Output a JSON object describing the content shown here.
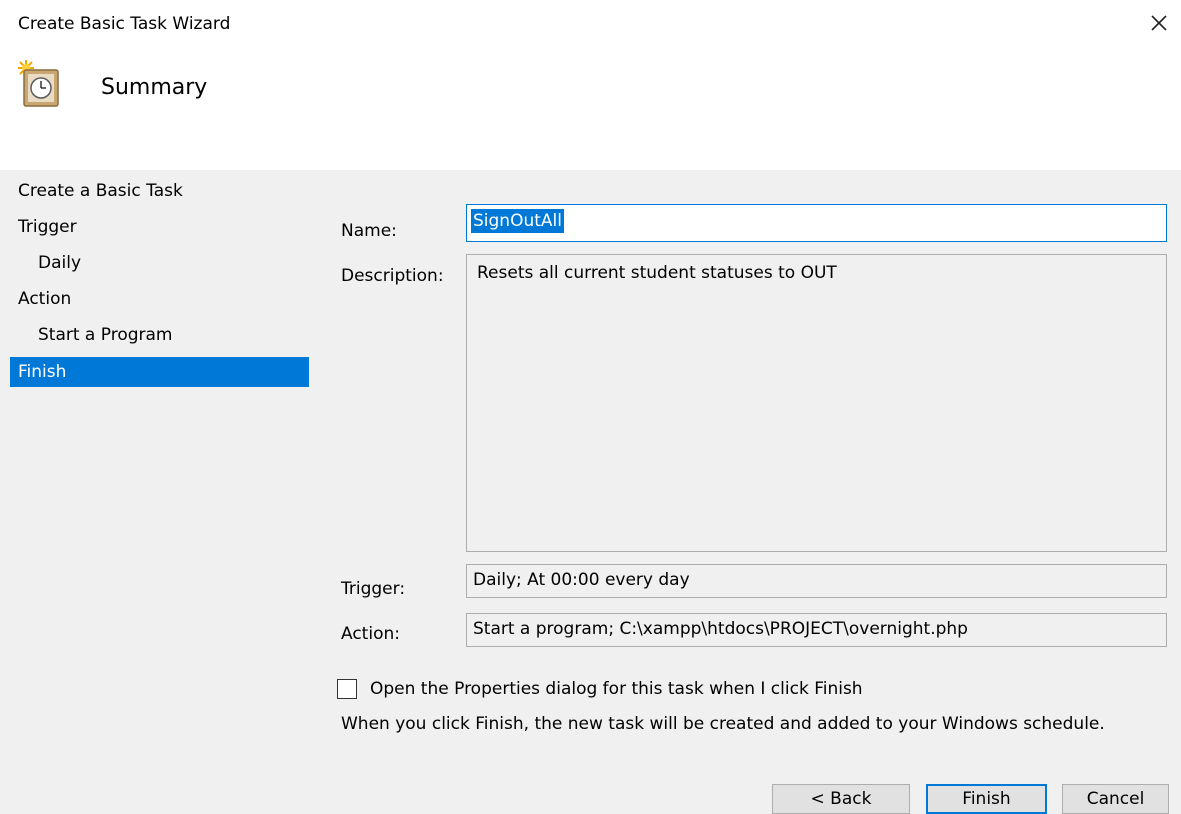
{
  "window": {
    "title": "Create Basic Task Wizard",
    "close_icon": "close-icon"
  },
  "header": {
    "icon": "task-clock-icon",
    "title": "Summary"
  },
  "nav": {
    "items": [
      {
        "label": "Create a Basic Task",
        "indent": false,
        "active": false
      },
      {
        "label": "Trigger",
        "indent": false,
        "active": false
      },
      {
        "label": "Daily",
        "indent": true,
        "active": false
      },
      {
        "label": "Action",
        "indent": false,
        "active": false
      },
      {
        "label": "Start a Program",
        "indent": true,
        "active": false
      },
      {
        "label": "Finish",
        "indent": false,
        "active": true
      }
    ]
  },
  "form": {
    "name_label": "Name:",
    "name_value": "SignOutAll",
    "description_label": "Description:",
    "description_value": "Resets all current student statuses to OUT",
    "trigger_label": "Trigger:",
    "trigger_value": "Daily; At 00:00 every day",
    "action_label": "Action:",
    "action_value": "Start a program; C:\\xampp\\htdocs\\PROJECT\\overnight.php"
  },
  "open_properties": {
    "label": "Open the Properties dialog for this task when I click Finish",
    "checked": false
  },
  "info_text": "When you click Finish, the new task will be created and added to your Windows schedule.",
  "buttons": {
    "back": "< Back",
    "finish": "Finish",
    "cancel": "Cancel"
  },
  "colors": {
    "accent": "#0078d7",
    "panel_background": "#f0f0f0",
    "window_background": "#ffffff"
  }
}
